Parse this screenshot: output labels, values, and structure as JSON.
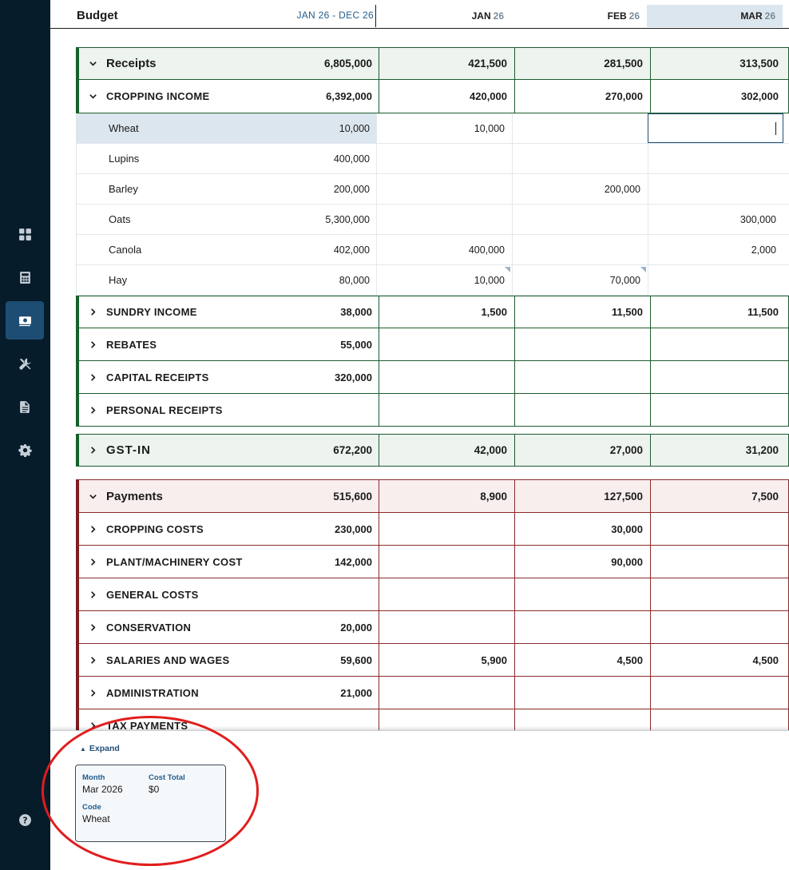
{
  "header": {
    "title": "Budget",
    "range": "JAN 26 - DEC 26",
    "months": [
      {
        "month": "JAN",
        "year": "26"
      },
      {
        "month": "FEB",
        "year": "26"
      },
      {
        "month": "MAR",
        "year": "26"
      }
    ]
  },
  "sidebar": {
    "icons": [
      "dashboard-icon",
      "calculator-icon",
      "budget-cash-icon",
      "tools-icon",
      "document-icon",
      "settings-gear-icon",
      "help-icon"
    ]
  },
  "receipts": {
    "label": "Receipts",
    "total": "6,805,000",
    "m1": "421,500",
    "m2": "281,500",
    "m3": "313,500",
    "groups": {
      "cropping": {
        "label": "CROPPING INCOME",
        "total": "6,392,000",
        "m1": "420,000",
        "m2": "270,000",
        "m3": "302,000"
      },
      "sundry": {
        "label": "SUNDRY INCOME",
        "total": "38,000",
        "m1": "1,500",
        "m2": "11,500",
        "m3": "11,500"
      },
      "rebates": {
        "label": "REBATES",
        "total": "55,000",
        "m1": "",
        "m2": "",
        "m3": ""
      },
      "capital": {
        "label": "CAPITAL RECEIPTS",
        "total": "320,000",
        "m1": "",
        "m2": "",
        "m3": ""
      },
      "personal": {
        "label": "PERSONAL RECEIPTS",
        "total": "",
        "m1": "",
        "m2": "",
        "m3": ""
      }
    },
    "items": {
      "wheat": {
        "label": "Wheat",
        "total": "10,000",
        "m1": "10,000",
        "m2": "",
        "m3": ""
      },
      "lupins": {
        "label": "Lupins",
        "total": "400,000",
        "m1": "",
        "m2": "",
        "m3": ""
      },
      "barley": {
        "label": "Barley",
        "total": "200,000",
        "m1": "",
        "m2": "200,000",
        "m3": ""
      },
      "oats": {
        "label": "Oats",
        "total": "5,300,000",
        "m1": "",
        "m2": "",
        "m3": "300,000"
      },
      "canola": {
        "label": "Canola",
        "total": "402,000",
        "m1": "400,000",
        "m2": "",
        "m3": "2,000"
      },
      "hay": {
        "label": "Hay",
        "total": "80,000",
        "m1": "10,000",
        "m2": "70,000",
        "m3": ""
      }
    }
  },
  "gst_in": {
    "label": "GST-IN",
    "total": "672,200",
    "m1": "42,000",
    "m2": "27,000",
    "m3": "31,200"
  },
  "payments": {
    "label": "Payments",
    "total": "515,600",
    "m1": "8,900",
    "m2": "127,500",
    "m3": "7,500",
    "groups": {
      "cropping": {
        "label": "CROPPING COSTS",
        "total": "230,000",
        "m1": "",
        "m2": "30,000",
        "m3": ""
      },
      "plant": {
        "label": "PLANT/MACHINERY COST",
        "total": "142,000",
        "m1": "",
        "m2": "90,000",
        "m3": ""
      },
      "general": {
        "label": "GENERAL COSTS",
        "total": "",
        "m1": "",
        "m2": "",
        "m3": ""
      },
      "conservation": {
        "label": "CONSERVATION",
        "total": "20,000",
        "m1": "",
        "m2": "",
        "m3": ""
      },
      "salaries": {
        "label": "SALARIES AND WAGES",
        "total": "59,600",
        "m1": "5,900",
        "m2": "4,500",
        "m3": "4,500"
      },
      "admin": {
        "label": "ADMINISTRATION",
        "total": "21,000",
        "m1": "",
        "m2": "",
        "m3": ""
      },
      "tax": {
        "label": "TAX PAYMENTS",
        "total": "",
        "m1": "",
        "m2": "",
        "m3": ""
      }
    }
  },
  "details": {
    "expand_label": "Expand",
    "month_label": "Month",
    "month_value": "Mar 2026",
    "cost_total_label": "Cost Total",
    "cost_total_value": "$0",
    "code_label": "Code",
    "code_value": "Wheat"
  },
  "colors": {
    "receipts_accent": "#15602a",
    "payments_accent": "#7d1e1e",
    "sidebar": "#061c2b",
    "selected_column": "#dce6ee",
    "annotation": "#e11d1d"
  }
}
